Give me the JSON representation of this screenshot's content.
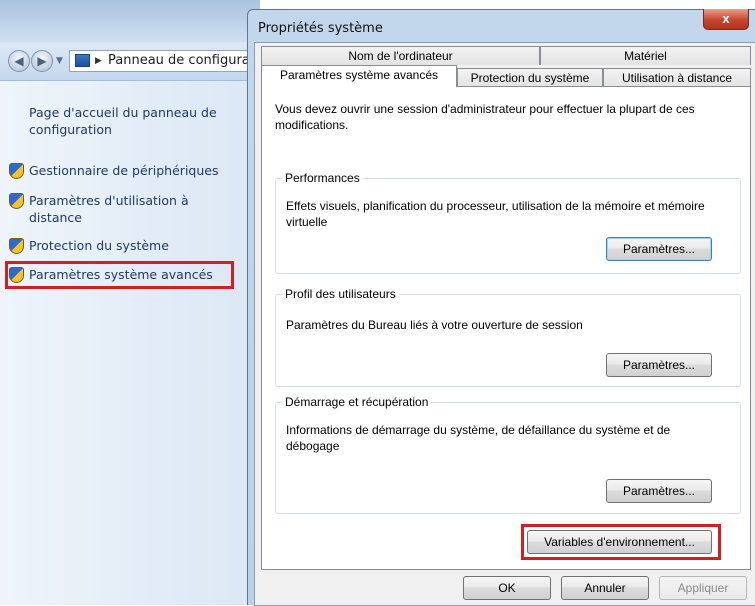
{
  "control_panel": {
    "address_path": "Panneau de configuration",
    "sidebar": {
      "home_link": "Page d'accueil du panneau de configuration",
      "items": [
        {
          "label": "Gestionnaire de périphériques",
          "icon": "uac-shield-icon"
        },
        {
          "label": "Paramètres d'utilisation à distance",
          "icon": "uac-shield-icon"
        },
        {
          "label": "Protection du système",
          "icon": "uac-shield-icon"
        },
        {
          "label": "Paramètres système avancés",
          "icon": "uac-shield-icon",
          "highlighted": true
        }
      ]
    }
  },
  "dialog": {
    "title": "Propriétés système",
    "close_glyph": "x",
    "tabs": [
      {
        "label": "Nom de l'ordinateur"
      },
      {
        "label": "Matériel"
      },
      {
        "label": "Paramètres système avancés",
        "selected": true
      },
      {
        "label": "Protection du système"
      },
      {
        "label": "Utilisation à distance"
      }
    ],
    "admin_note": "Vous devez ouvrir une session d'administrateur pour effectuer la plupart de ces modifications.",
    "groups": {
      "performance": {
        "title": "Performances",
        "description": "Effets visuels, planification du processeur, utilisation de la mémoire et mémoire virtuelle",
        "button": "Paramètres..."
      },
      "user_profiles": {
        "title": "Profil des utilisateurs",
        "description": "Paramètres du Bureau liés à votre ouverture de session",
        "button": "Paramètres..."
      },
      "startup_recovery": {
        "title": "Démarrage et récupération",
        "description": "Informations de démarrage du système, de défaillance du système et de débogage",
        "button": "Paramètres..."
      }
    },
    "env_button": "Variables d'environnement...",
    "footer": {
      "ok": "OK",
      "cancel": "Annuler",
      "apply": "Appliquer"
    }
  },
  "colors": {
    "highlight": "#d11f24",
    "link": "#1e3a66",
    "close_button": "#c7452b"
  }
}
